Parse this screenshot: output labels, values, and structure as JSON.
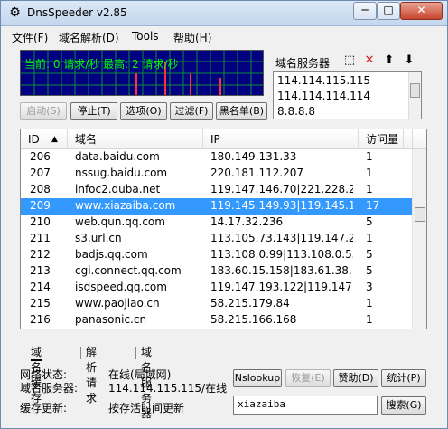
{
  "window": {
    "title": "DnsSpeeder v2.85",
    "minimize_label": "─",
    "maximize_label": "□",
    "close_label": "✕"
  },
  "menu": [
    "文件(F)",
    "域名解析(D)",
    "Tools",
    "帮助(H)"
  ],
  "monitor": {
    "text": "当前: 0 请求/秒 最高: 2 请求/秒"
  },
  "toolbar": {
    "start": "启动(S)",
    "stop": "停止(T)",
    "options": "选项(O)",
    "filter": "过滤(F)",
    "blacklist": "黑名单(B)"
  },
  "dns_servers": {
    "label": "域名服务器",
    "items": [
      "114.114.115.115",
      "114.114.114.114",
      "8.8.8.8"
    ]
  },
  "table": {
    "columns": [
      "ID",
      "域名",
      "IP",
      "访问量"
    ],
    "rows": [
      {
        "id": "206",
        "domain": "data.baidu.com",
        "ip": "180.149.131.33",
        "count": "1"
      },
      {
        "id": "207",
        "domain": "nssug.baidu.com",
        "ip": "220.181.112.207",
        "count": "1"
      },
      {
        "id": "208",
        "domain": "infoc2.duba.net",
        "ip": "119.147.146.70|221.228.2...",
        "count": "1"
      },
      {
        "id": "209",
        "domain": "www.xiazaiba.com",
        "ip": "119.145.149.93|119.145.1...",
        "count": "17"
      },
      {
        "id": "210",
        "domain": "web.qun.qq.com",
        "ip": "14.17.32.236",
        "count": "5"
      },
      {
        "id": "211",
        "domain": "s3.url.cn",
        "ip": "113.105.73.143|119.147.2...",
        "count": "1"
      },
      {
        "id": "212",
        "domain": "badjs.qq.com",
        "ip": "113.108.0.99|113.108.0.55",
        "count": "5"
      },
      {
        "id": "213",
        "domain": "cgi.connect.qq.com",
        "ip": "183.60.15.158|183.61.38.1...",
        "count": "5"
      },
      {
        "id": "214",
        "domain": "isdspeed.qq.com",
        "ip": "119.147.193.122|119.147....",
        "count": "3"
      },
      {
        "id": "215",
        "domain": "www.paojiao.cn",
        "ip": "58.215.179.84",
        "count": "1"
      },
      {
        "id": "216",
        "domain": "panasonic.cn",
        "ip": "58.215.166.168",
        "count": "1"
      }
    ],
    "selected_id": "209"
  },
  "tabs": [
    "域名缓存",
    "解析请求",
    "域名服务器"
  ],
  "status": {
    "network_label": "网络状态:",
    "network_value": "在线(局域网)",
    "dns_label": "域名服务器:",
    "dns_value": "114.114.115.115/在线",
    "cache_label": "缓存更新:",
    "cache_value": "按存活时间更新"
  },
  "bottom_buttons": {
    "nslookup": "Nslookup",
    "restore": "恢复(E)",
    "donate": "赞助(D)",
    "stats": "统计(P)",
    "search": "搜索(G)"
  },
  "search_input": {
    "value": "xiazaiba"
  }
}
